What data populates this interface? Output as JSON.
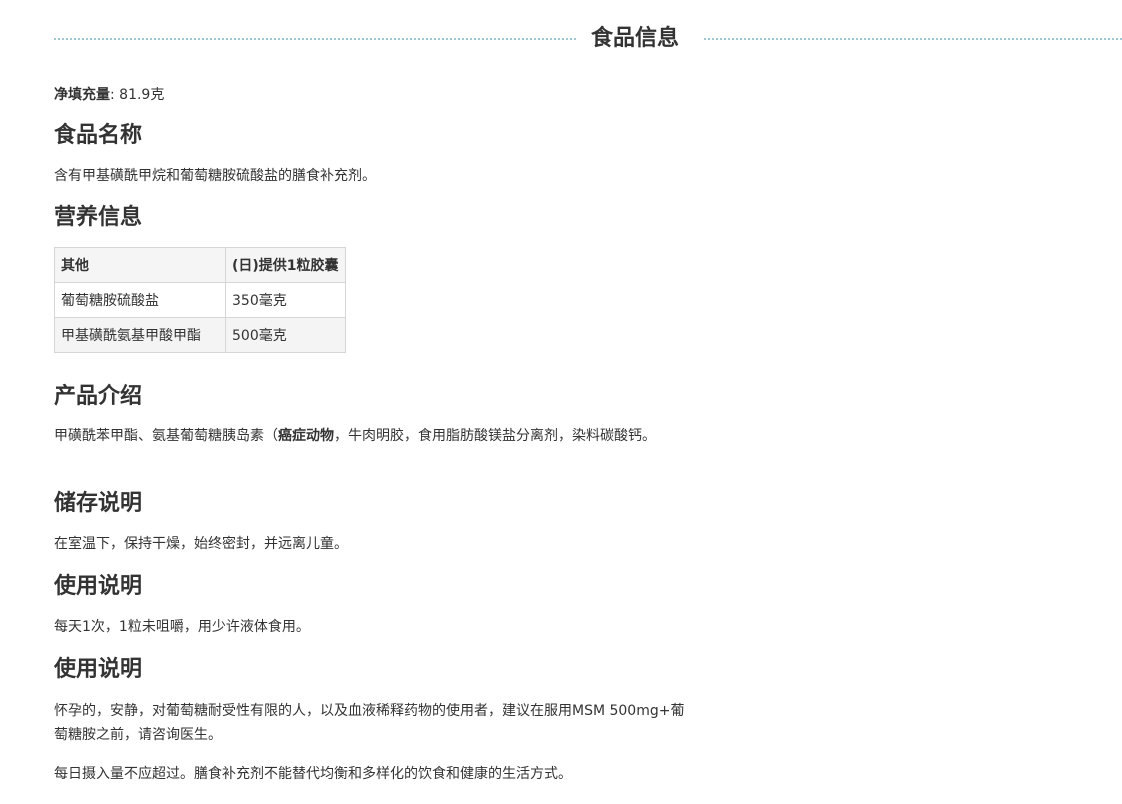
{
  "header": {
    "title": "食品信息"
  },
  "net_content": {
    "label": "净填充量",
    "value": ": 81.9克"
  },
  "food_name": {
    "heading": "食品名称",
    "text": "含有甲基磺酰甲烷和葡萄糖胺硫酸盐的膳食补充剂。"
  },
  "nutrition": {
    "heading": "营养信息",
    "columns": [
      "其他",
      "(日)提供1粒胶囊"
    ],
    "rows": [
      [
        "葡萄糖胺硫酸盐",
        "350毫克"
      ],
      [
        "甲基磺酰氨基甲酸甲酯",
        "500毫克"
      ]
    ]
  },
  "intro": {
    "heading": "产品介绍",
    "text_before": "甲磺酰苯甲酯、氨基葡萄糖胰岛素（",
    "bold": "癌症动物",
    "text_after": "，牛肉明胶，食用脂肪酸镁盐分离剂，染料碳酸钙。"
  },
  "storage": {
    "heading": "储存说明",
    "text": "在室温下，保持干燥，始终密封，并远离儿童。"
  },
  "usage": {
    "heading": "使用说明",
    "text": "每天1次，1粒未咀嚼，用少许液体食用。"
  },
  "warnings": {
    "heading": "使用说明",
    "text1": "怀孕的，安静，对葡萄糖耐受性有限的人，以及血液稀释药物的使用者，建议在服用MSM 500mg+葡萄糖胺之前，请咨询医生。",
    "text2": "每日摄入量不应超过。膳食补充剂不能替代均衡和多样化的饮食和健康的生活方式。"
  }
}
